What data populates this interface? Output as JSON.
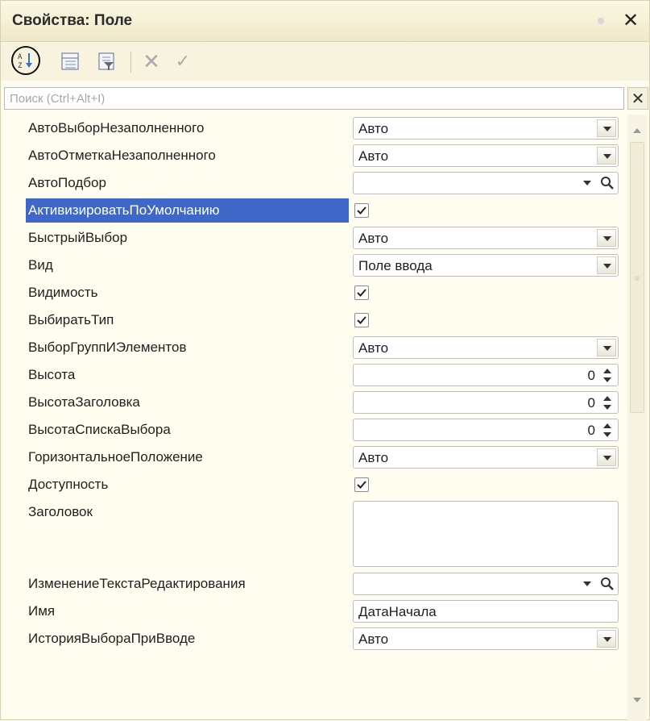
{
  "panel": {
    "title": "Свойства: Поле",
    "close_label": "✕"
  },
  "toolbar": {
    "sort_icon": "sort-alphabetical-icon",
    "categories_icon": "categories-icon",
    "filter_icon": "filter-icon",
    "cancel_label": "✕",
    "apply_label": "✓"
  },
  "search": {
    "placeholder": "Поиск (Ctrl+Alt+I)",
    "value": "",
    "clear_label": "✕"
  },
  "colors": {
    "selection": "#3f67c8",
    "panel_bg": "#fffdf0",
    "titlebar_bg": "#efe9c9"
  },
  "properties": [
    {
      "name": "АвтоВыборНезаполненного",
      "kind": "dropdown",
      "value": "Авто"
    },
    {
      "name": "АвтоОтметкаНезаполненного",
      "kind": "dropdown",
      "value": "Авто"
    },
    {
      "name": "АвтоПодбор",
      "kind": "dropdown-search",
      "value": ""
    },
    {
      "name": "АктивизироватьПоУмолчанию",
      "kind": "checkbox",
      "checked": true,
      "selected": true
    },
    {
      "name": "БыстрыйВыбор",
      "kind": "dropdown",
      "value": "Авто"
    },
    {
      "name": "Вид",
      "kind": "dropdown",
      "value": "Поле ввода"
    },
    {
      "name": "Видимость",
      "kind": "checkbox",
      "checked": true
    },
    {
      "name": "ВыбиратьТип",
      "kind": "checkbox",
      "checked": true
    },
    {
      "name": "ВыборГруппИЭлементов",
      "kind": "dropdown",
      "value": "Авто"
    },
    {
      "name": "Высота",
      "kind": "number",
      "value": "0"
    },
    {
      "name": "ВысотаЗаголовка",
      "kind": "number",
      "value": "0"
    },
    {
      "name": "ВысотаСпискаВыбора",
      "kind": "number",
      "value": "0"
    },
    {
      "name": "ГоризонтальноеПоложение",
      "kind": "dropdown",
      "value": "Авто"
    },
    {
      "name": "Доступность",
      "kind": "checkbox",
      "checked": true
    },
    {
      "name": "Заголовок",
      "kind": "textarea",
      "value": ""
    },
    {
      "name": "ИзменениеТекстаРедактирования",
      "kind": "dropdown-search",
      "value": ""
    },
    {
      "name": "Имя",
      "kind": "text",
      "value": "ДатаНачала"
    },
    {
      "name": "ИсторияВыбораПриВводе",
      "kind": "dropdown",
      "value": "Авто"
    }
  ]
}
